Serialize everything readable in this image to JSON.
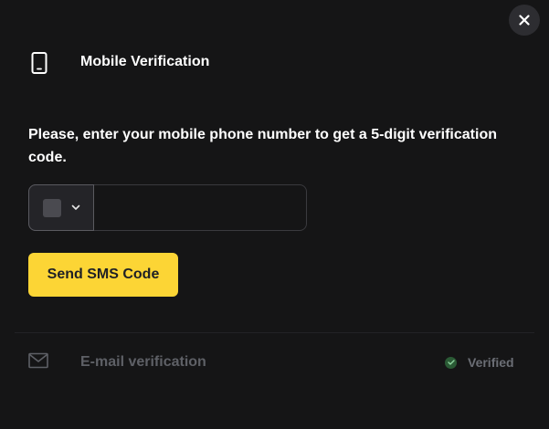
{
  "header": {
    "title": "Mobile Verification",
    "icon": "phone-icon"
  },
  "close": {
    "icon": "close-icon"
  },
  "instructions": "Please, enter your mobile phone number to get a 5-digit verification code.",
  "phone": {
    "country_icon": "flag-placeholder",
    "value": "",
    "placeholder": ""
  },
  "send_button": {
    "label": "Send SMS Code"
  },
  "email": {
    "label": "E-mail verification",
    "icon": "mail-icon",
    "status": "Verified",
    "status_color": "#2a5a35"
  },
  "colors": {
    "background": "#151516",
    "accent": "#fcd535"
  }
}
